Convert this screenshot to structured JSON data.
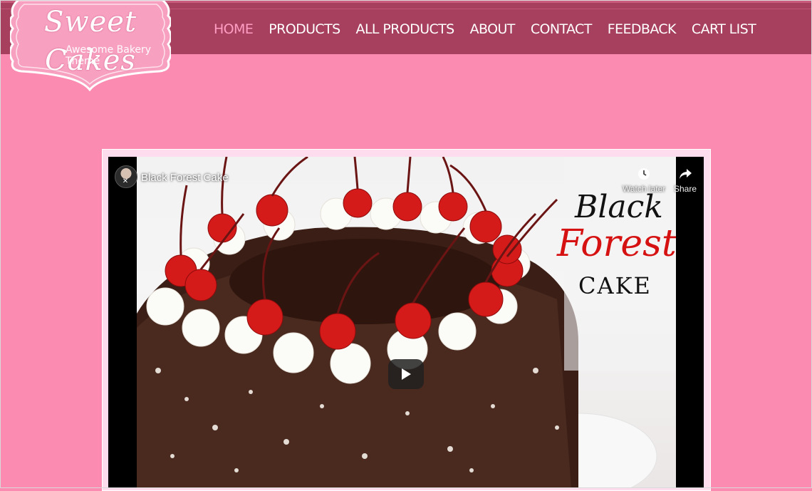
{
  "brand": {
    "name": "Sweet Cakes",
    "tagline": "Awesome Bakery Theme"
  },
  "nav": {
    "items": [
      {
        "label": "HOME",
        "active": true
      },
      {
        "label": "PRODUCTS",
        "active": false
      },
      {
        "label": "ALL PRODUCTS",
        "active": false
      },
      {
        "label": "ABOUT",
        "active": false
      },
      {
        "label": "CONTACT",
        "active": false
      },
      {
        "label": "FEEDBACK",
        "active": false
      },
      {
        "label": "CART LIST",
        "active": false
      }
    ]
  },
  "video": {
    "title": "Black Forest Cake",
    "watch_later": "Watch later",
    "share": "Share",
    "thumb_text": {
      "line1": "Black",
      "line2": "Forest",
      "line3": "CAKE"
    }
  },
  "colors": {
    "page_bg": "#fb8bb0",
    "header_bg": "#a7405e",
    "nav_active": "#ff9dc3",
    "logo_pink": "#f7a0c0"
  }
}
